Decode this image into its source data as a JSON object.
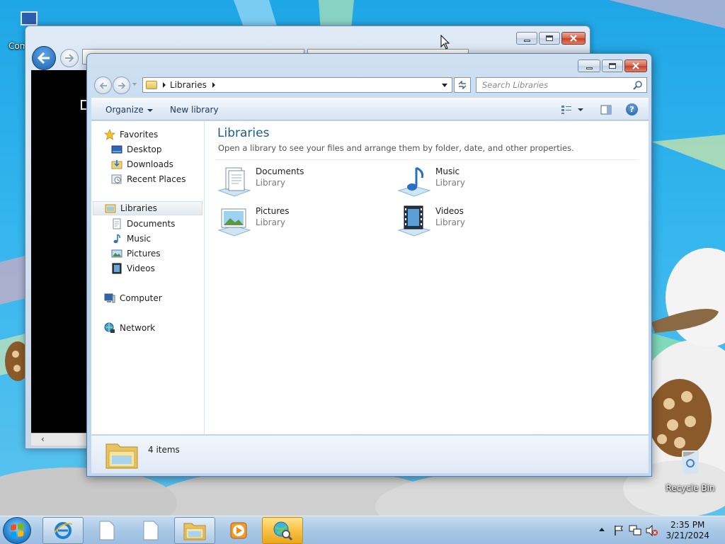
{
  "desktop": {
    "icons": [
      {
        "label": "Com"
      },
      {
        "label": "Recycle Bin"
      }
    ]
  },
  "explorer": {
    "breadcrumb": "Libraries",
    "search_placeholder": "Search Libraries",
    "toolbar": {
      "organize": "Organize",
      "new_library": "New library"
    },
    "nav": {
      "favorites": "Favorites",
      "desktop": "Desktop",
      "downloads": "Downloads",
      "recent_places": "Recent Places",
      "libraries": "Libraries",
      "documents": "Documents",
      "music": "Music",
      "pictures": "Pictures",
      "videos": "Videos",
      "computer": "Computer",
      "network": "Network"
    },
    "content": {
      "title": "Libraries",
      "subtitle": "Open a library to see your files and arrange them by folder, date, and other properties.",
      "libraries": [
        {
          "name": "Documents",
          "type": "Library",
          "icon": "documents-library-icon"
        },
        {
          "name": "Music",
          "type": "Library",
          "icon": "music-library-icon"
        },
        {
          "name": "Pictures",
          "type": "Library",
          "icon": "pictures-library-icon"
        },
        {
          "name": "Videos",
          "type": "Library",
          "icon": "videos-library-icon"
        }
      ]
    },
    "status": {
      "item_count": "4 items"
    }
  },
  "taskbar": {
    "clock_time": "2:35 PM",
    "clock_date": "3/21/2024"
  },
  "colors": {
    "accent_title": "#1e5c8c",
    "taskbar_active": "#f7c144",
    "desktop_sky": "#33b5ee"
  }
}
